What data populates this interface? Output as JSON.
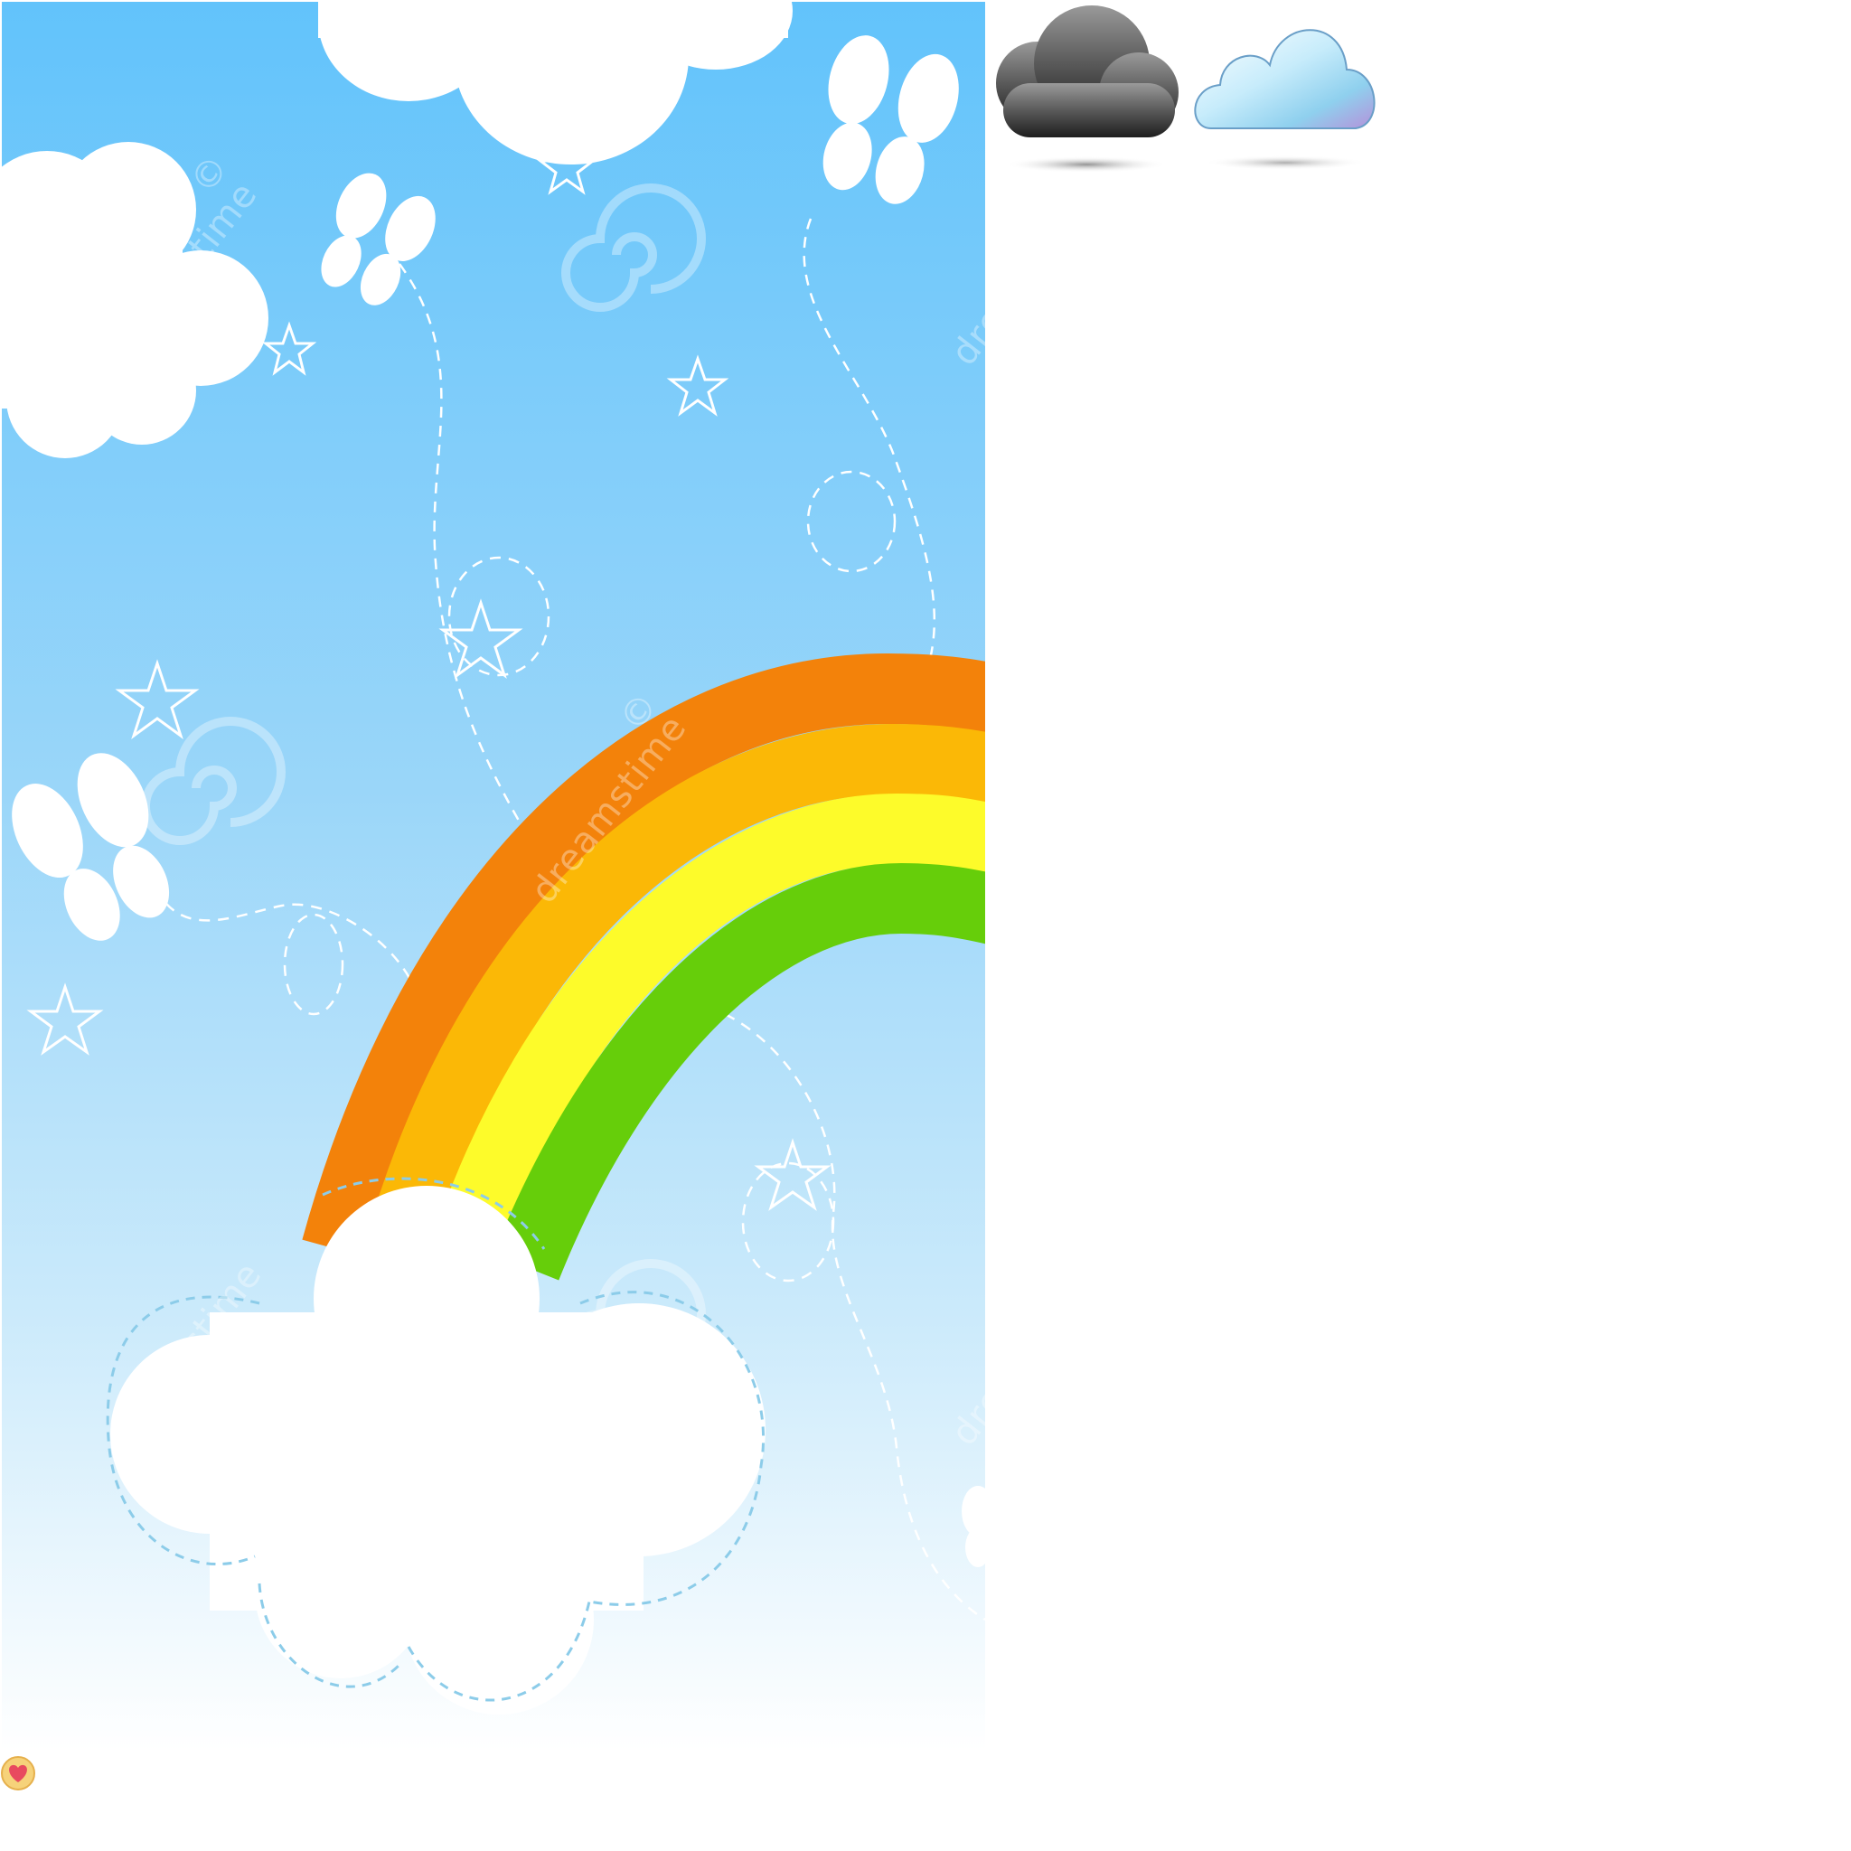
{
  "panel": {
    "watermark": "dreamstime",
    "watermark_mark": "©",
    "watermark_partial": "dre"
  },
  "colors": {
    "sky_top": "#62c3fb",
    "sky_mid": "#a7dbf8",
    "sky_bottom": "#ffffff",
    "rainbow_orange": "#f3820a",
    "rainbow_amber": "#fbb806",
    "rainbow_yellow": "#fdfb2a",
    "rainbow_green": "#66ce0a",
    "cloud_white": "#ffffff",
    "dashed_line": "#8ccce9",
    "storm_cloud": "#3a3a3a",
    "sky_cloud": "#a9dcf5",
    "badge": "#e84a5f"
  },
  "icons": {
    "storm_cloud": "storm-cloud-icon",
    "sky_cloud": "sky-cloud-icon",
    "favorite": "heart-badge-icon"
  }
}
